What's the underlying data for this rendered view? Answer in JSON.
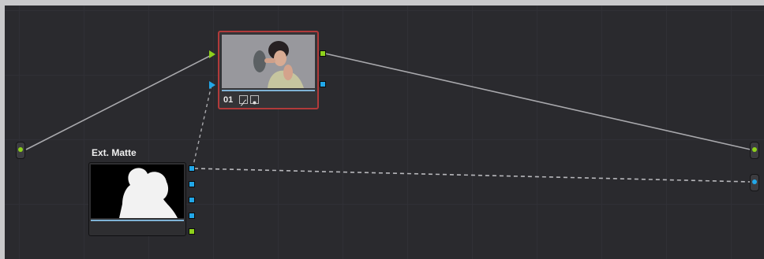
{
  "nodes": {
    "main": {
      "label": "01",
      "tools": [
        "curves-icon",
        "window-icon"
      ]
    },
    "matte": {
      "title": "Ext. Matte"
    }
  },
  "colors": {
    "background": "#2a2a2e",
    "rgb_connection": "#8ed11c",
    "key_connection": "#22a7e8",
    "selected_outline": "#b13a3a"
  }
}
